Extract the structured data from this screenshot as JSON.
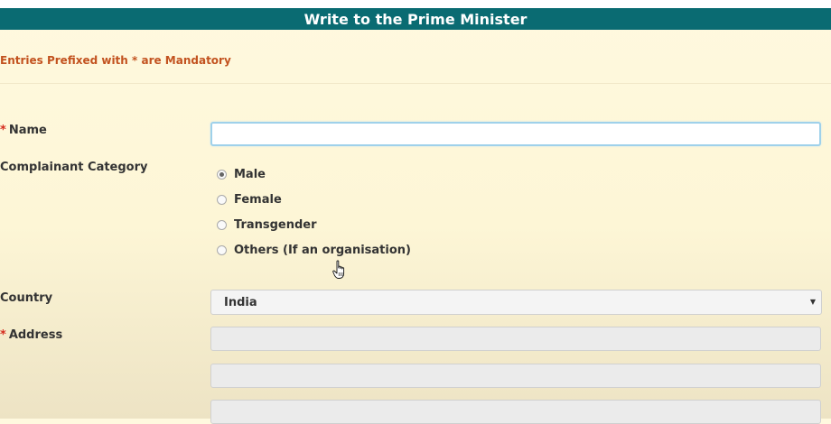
{
  "header": {
    "title": "Write to the Prime Minister"
  },
  "notice": {
    "text": "Entries Prefixed with * are Mandatory"
  },
  "form": {
    "name": {
      "required_marker": "*",
      "label": "Name",
      "value": ""
    },
    "category": {
      "label": "Complainant Category",
      "options": [
        "Male",
        "Female",
        "Transgender",
        "Others (If an organisation)"
      ],
      "selected": "Male"
    },
    "country": {
      "label": "Country",
      "selected": "India"
    },
    "address": {
      "required_marker": "*",
      "label": "Address",
      "line1": "",
      "line2": "",
      "line3": ""
    }
  },
  "icons": {
    "cursor": "hand-pointer-icon",
    "dropdown": "caret-down-icon"
  },
  "colors": {
    "header_bg": "#0a6b72",
    "notice_text": "#c2521f",
    "required_marker": "#d52b1e"
  }
}
